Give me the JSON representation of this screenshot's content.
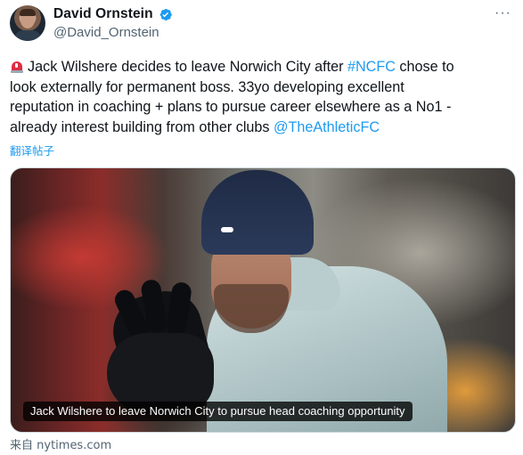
{
  "tweet": {
    "author_name": "David Ornstein",
    "author_handle": "@David_Ornstein",
    "verified": true,
    "more_label": "···",
    "text": {
      "line1_a": "Jack Wilshere decides to leave Norwich City after ",
      "line1_hashtag": "#NCFC",
      "line1_b": " chose to",
      "line2": "look externally for permanent boss. 33yo developing excellent",
      "line3": "reputation in coaching + plans to pursue career elsewhere as a No1 -",
      "line4_a": "already interest building from other clubs ",
      "line4_mention": "@TheAthleticFC"
    },
    "translate_label": "翻译帖子",
    "media": {
      "caption": "Jack Wilshere to leave Norwich City to pursue head coaching opportunity"
    },
    "source_label": "来自 nytimes.com"
  },
  "colors": {
    "link": "#1d9bf0",
    "text": "#0f1419",
    "muted": "#536471",
    "verified": "#1d9bf0",
    "siren": "#dd2e44"
  },
  "icons": {
    "verified": "verified-badge-icon",
    "siren": "police-siren-emoji-icon"
  }
}
